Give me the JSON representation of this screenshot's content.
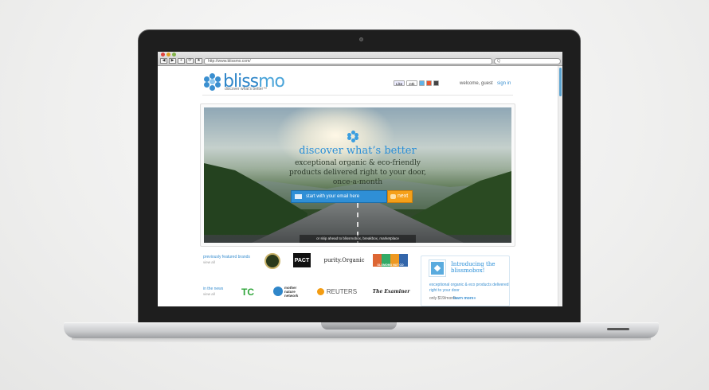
{
  "browser": {
    "url": "http://www.blissmo.com/",
    "search_placeholder": "Q",
    "nav_buttons": [
      "◀",
      "▶",
      "+",
      "⟳",
      "★"
    ]
  },
  "header": {
    "logo_text_blue": "bliss",
    "logo_text_light": "mo",
    "tagline": "discover what's better™",
    "fb_like": "Like",
    "fb_count": "24k",
    "welcome": "welcome, guest",
    "signin": "sign in"
  },
  "hero": {
    "title": "discover what’s better",
    "subtitle": "exceptional organic & eco-friendly products delivered right to your door, once-a-month",
    "email_placeholder": "start with your email here",
    "next_label": "next",
    "skip_text": "or skip ahead to blissmobox, breakbox, marketplace"
  },
  "brands": {
    "label": "previously featured brands",
    "view_all": "view all",
    "items": [
      "PACT",
      "purity.Organic",
      "OLOMOMO NUT CO"
    ]
  },
  "news": {
    "label": "in the news",
    "view_all": "view all",
    "items": [
      "TC",
      "mother nature network",
      "REUTERS",
      "The Examiner"
    ]
  },
  "promo": {
    "title": "Introducing the blissmobox!",
    "description": "exceptional organic & eco products delivered right to your door",
    "price": "only $19/month",
    "more": "learn more»"
  },
  "colors": {
    "brand_blue": "#2f86c9",
    "cta_orange": "#f5a019"
  }
}
